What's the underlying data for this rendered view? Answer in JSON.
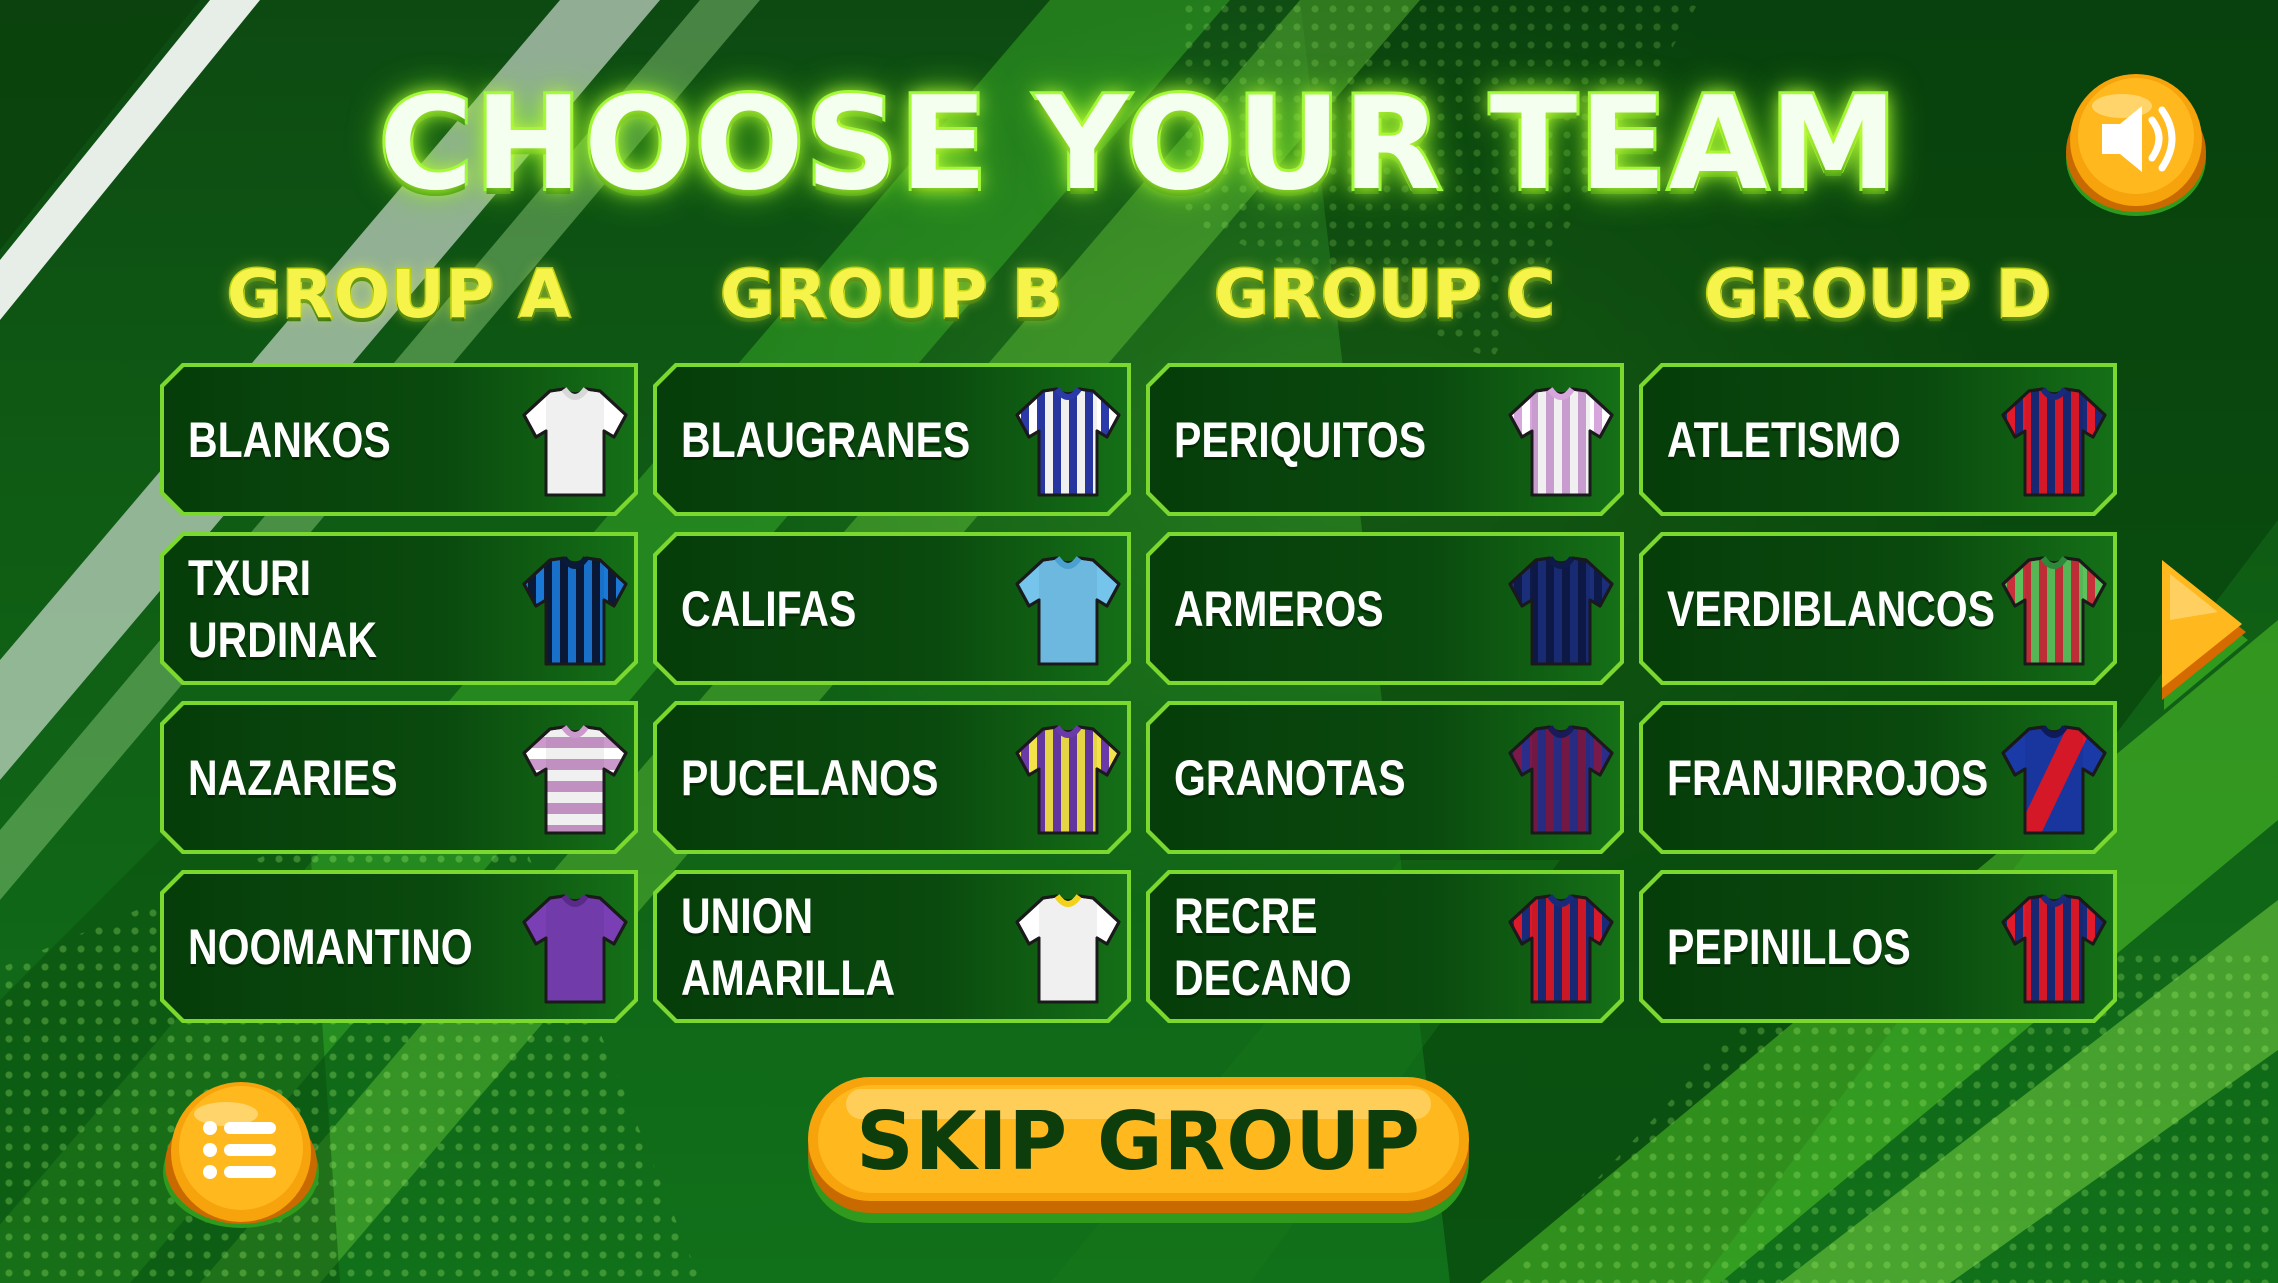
{
  "screen": {
    "title": "CHOOSE YOUR TEAM"
  },
  "colors": {
    "accent_green": "#7bd82e",
    "title_glow": "#c8ff3a",
    "group_header": "#f6f44a",
    "button_orange": "#f5a10a",
    "card_dark": "#063d0a"
  },
  "groups": [
    {
      "header": "GROUP A",
      "teams": [
        {
          "name": "BLANKOS",
          "jersey": {
            "icon": "jersey-white-icon",
            "base": "#ffffff",
            "stripe": "#ffffff",
            "pattern": "plain",
            "collar": "#d8d8d8"
          }
        },
        {
          "name": "TXURI URDINAK",
          "jersey": {
            "icon": "jersey-blue-black-stripes-icon",
            "base": "#1a78d6",
            "stripe": "#0a1a3a",
            "pattern": "vstripes",
            "collar": "#0a1a3a"
          }
        },
        {
          "name": "NAZARIES",
          "jersey": {
            "icon": "jersey-pink-white-hoops-icon",
            "base": "#ffffff",
            "stripe": "#cc99cc",
            "pattern": "hoops",
            "collar": "#cc99cc"
          }
        },
        {
          "name": "NOOMANTINO",
          "jersey": {
            "icon": "jersey-purple-icon",
            "base": "#7a3fb5",
            "stripe": "#7a3fb5",
            "pattern": "plain",
            "collar": "#5a2a8a"
          }
        }
      ]
    },
    {
      "header": "GROUP B",
      "teams": [
        {
          "name": "BLAUGRANES",
          "jersey": {
            "icon": "jersey-blue-white-stripes-icon",
            "base": "#ffffff",
            "stripe": "#2a3aa8",
            "pattern": "vstripes",
            "collar": "#2a3aa8"
          }
        },
        {
          "name": "CALIFAS",
          "jersey": {
            "icon": "jersey-sky-blue-icon",
            "base": "#74c4ec",
            "stripe": "#74c4ec",
            "pattern": "plain",
            "collar": "#4aa0d0"
          }
        },
        {
          "name": "PUCELANOS",
          "jersey": {
            "icon": "jersey-purple-yellow-stripes-icon",
            "base": "#f4e24a",
            "stripe": "#6a3aa8",
            "pattern": "vstripes",
            "collar": "#6a3aa8"
          }
        },
        {
          "name": "UNION AMARILLA",
          "jersey": {
            "icon": "jersey-white-yellow-trim-icon",
            "base": "#ffffff",
            "stripe": "#ffffff",
            "pattern": "plain",
            "collar": "#f2d21a"
          }
        }
      ]
    },
    {
      "header": "GROUP C",
      "teams": [
        {
          "name": "PERIQUITOS",
          "jersey": {
            "icon": "jersey-pink-white-stripes-icon",
            "base": "#ffffff",
            "stripe": "#d6a6dc",
            "pattern": "vstripes",
            "collar": "#d6a6dc"
          }
        },
        {
          "name": "ARMEROS",
          "jersey": {
            "icon": "jersey-navy-stripes-icon",
            "base": "#1a2e7a",
            "stripe": "#0e1a4a",
            "pattern": "vstripes",
            "collar": "#0e1a4a"
          }
        },
        {
          "name": "GRANOTAS",
          "jersey": {
            "icon": "jersey-navy-maroon-stripes-icon",
            "base": "#2a2e8a",
            "stripe": "#7a1a4a",
            "pattern": "vstripes",
            "collar": "#1a1a5a"
          }
        },
        {
          "name": "RECRE DECANO",
          "jersey": {
            "icon": "jersey-red-navy-stripes-icon",
            "base": "#1a2a7a",
            "stripe": "#d81a2a",
            "pattern": "vstripes",
            "collar": "#1a2a7a"
          }
        }
      ]
    },
    {
      "header": "GROUP D",
      "teams": [
        {
          "name": "ATLETISMO",
          "jersey": {
            "icon": "jersey-red-navy-stripes-icon",
            "base": "#1a2a7a",
            "stripe": "#e21a2a",
            "pattern": "vstripes",
            "collar": "#1a2a7a"
          }
        },
        {
          "name": "VERDIBLANCOS",
          "jersey": {
            "icon": "jersey-green-red-stripes-icon",
            "base": "#5cc25c",
            "stripe": "#c8303a",
            "pattern": "vstripes",
            "collar": "#2a8a3a"
          }
        },
        {
          "name": "FRANJIRROJOS",
          "jersey": {
            "icon": "jersey-blue-red-sash-icon",
            "base": "#1a3aa8",
            "stripe": "#e21a2a",
            "pattern": "sash",
            "collar": "#0e1a5a"
          }
        },
        {
          "name": "PEPINILLOS",
          "jersey": {
            "icon": "jersey-red-navy-stripes-icon",
            "base": "#1a2a7a",
            "stripe": "#e21a2a",
            "pattern": "vstripes",
            "collar": "#1a2a7a"
          }
        }
      ]
    }
  ],
  "controls": {
    "skip_label": "SKIP GROUP",
    "sound_icon": "speaker-icon",
    "menu_icon": "list-menu-icon",
    "next_icon": "next-arrow-icon"
  }
}
